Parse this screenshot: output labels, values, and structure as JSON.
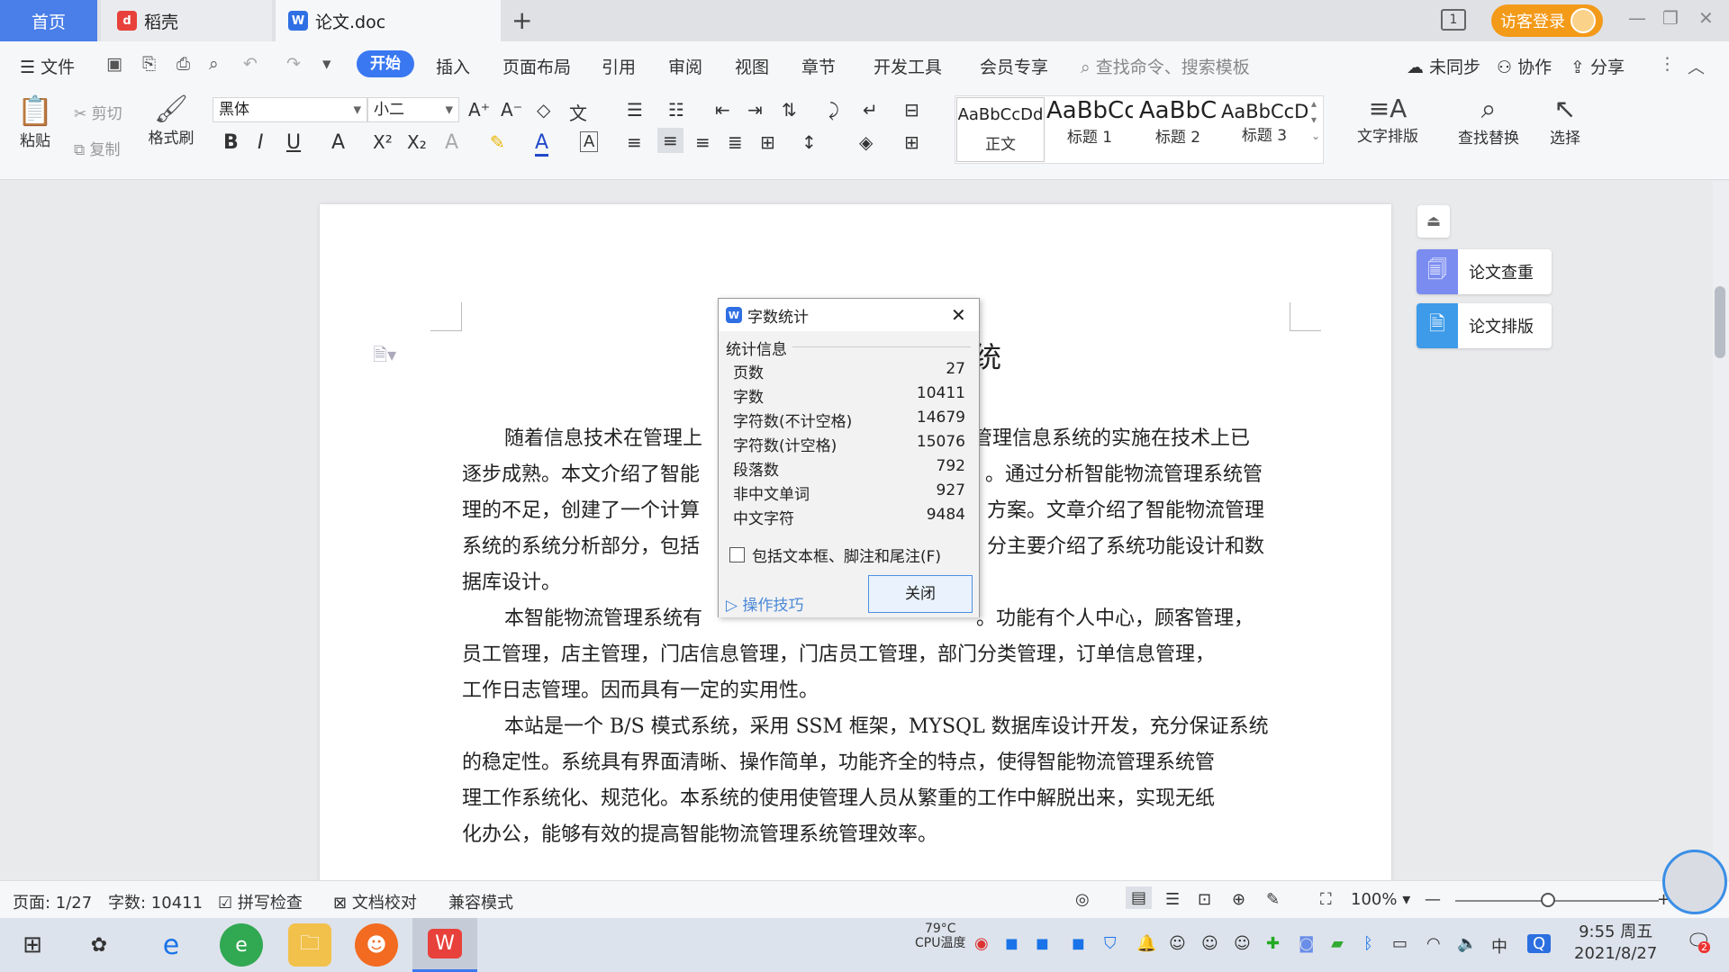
{
  "titlebar": {
    "tabs": [
      {
        "label": "首页"
      },
      {
        "label": "稻壳"
      },
      {
        "label": "论文.doc"
      }
    ],
    "new_tab": "+",
    "page_count_icon": "1",
    "login": "访客登录"
  },
  "menubar": {
    "file": "文件",
    "items": [
      "开始",
      "插入",
      "页面布局",
      "引用",
      "审阅",
      "视图",
      "章节",
      "开发工具",
      "会员专享"
    ],
    "search_placeholder": "查找命令、搜索模板",
    "sync": "未同步",
    "collab": "协作",
    "share": "分享"
  },
  "ribbon": {
    "paste": "粘贴",
    "cut": "剪切",
    "copy": "复制",
    "format_painter": "格式刷",
    "font": "黑体",
    "size": "小二",
    "styles": [
      {
        "preview": "AaBbCcDd",
        "label": "正文"
      },
      {
        "preview": "AaBbCc",
        "label": "标题 1"
      },
      {
        "preview": "AaBbC",
        "label": "标题 2"
      },
      {
        "preview": "AaBbCcD",
        "label": "标题 3"
      }
    ],
    "text_layout": "文字排版",
    "find_replace": "查找替换",
    "select": "选择"
  },
  "document": {
    "title_partial": "统",
    "lines": [
      "随着信息技术在管理上",
      "管理信息系统的实施在技术上已",
      "逐步成熟。本文介绍了智能",
      "。通过分析智能物流管理系统管",
      "理的不足，创建了一个计算",
      "方案。文章介绍了智能物流管理",
      "系统的系统分析部分，包括",
      "分主要介绍了系统功能设计和数",
      "据库设计。",
      "本智能物流管理系统有",
      "。功能有个人中心，顾客管理，",
      "员工管理，店主管理，门店信息管理，门店员工管理，部门分类管理，订单信息管理，",
      "工作日志管理。因而具有一定的实用性。",
      "本站是一个 B/S 模式系统，采用 SSM 框架，MYSQL 数据库设计开发，充分保证系统",
      "的稳定性。系统具有界面清晰、操作简单，功能齐全的特点，使得智能物流管理系统管",
      "理工作系统化、规范化。本系统的使用使管理人员从繁重的工作中解脱出来，实现无纸",
      "化办公，能够有效的提高智能物流管理系统管理效率。"
    ]
  },
  "dialog": {
    "title": "字数统计",
    "section": "统计信息",
    "stats": [
      {
        "label": "页数",
        "value": "27"
      },
      {
        "label": "字数",
        "value": "10411"
      },
      {
        "label": "字符数(不计空格)",
        "value": "14679"
      },
      {
        "label": "字符数(计空格)",
        "value": "15076"
      },
      {
        "label": "段落数",
        "value": "792"
      },
      {
        "label": "非中文单词",
        "value": "927"
      },
      {
        "label": "中文字符",
        "value": "9484"
      }
    ],
    "checkbox": "包括文本框、脚注和尾注(F)",
    "tips": "操作技巧",
    "close": "关闭"
  },
  "side_panel": {
    "check": "论文查重",
    "layout": "论文排版"
  },
  "statusbar": {
    "page": "页面: 1/27",
    "words": "字数: 10411",
    "spell": "拼写检查",
    "proof": "文档校对",
    "compat": "兼容模式",
    "zoom": "100%",
    "zoom_level": 0.5
  },
  "taskbar": {
    "cpu_temp": "79°C",
    "cpu_label": "CPU温度",
    "ime": "中",
    "time": "9:55 周五",
    "date": "2021/8/27",
    "notif": "2"
  }
}
